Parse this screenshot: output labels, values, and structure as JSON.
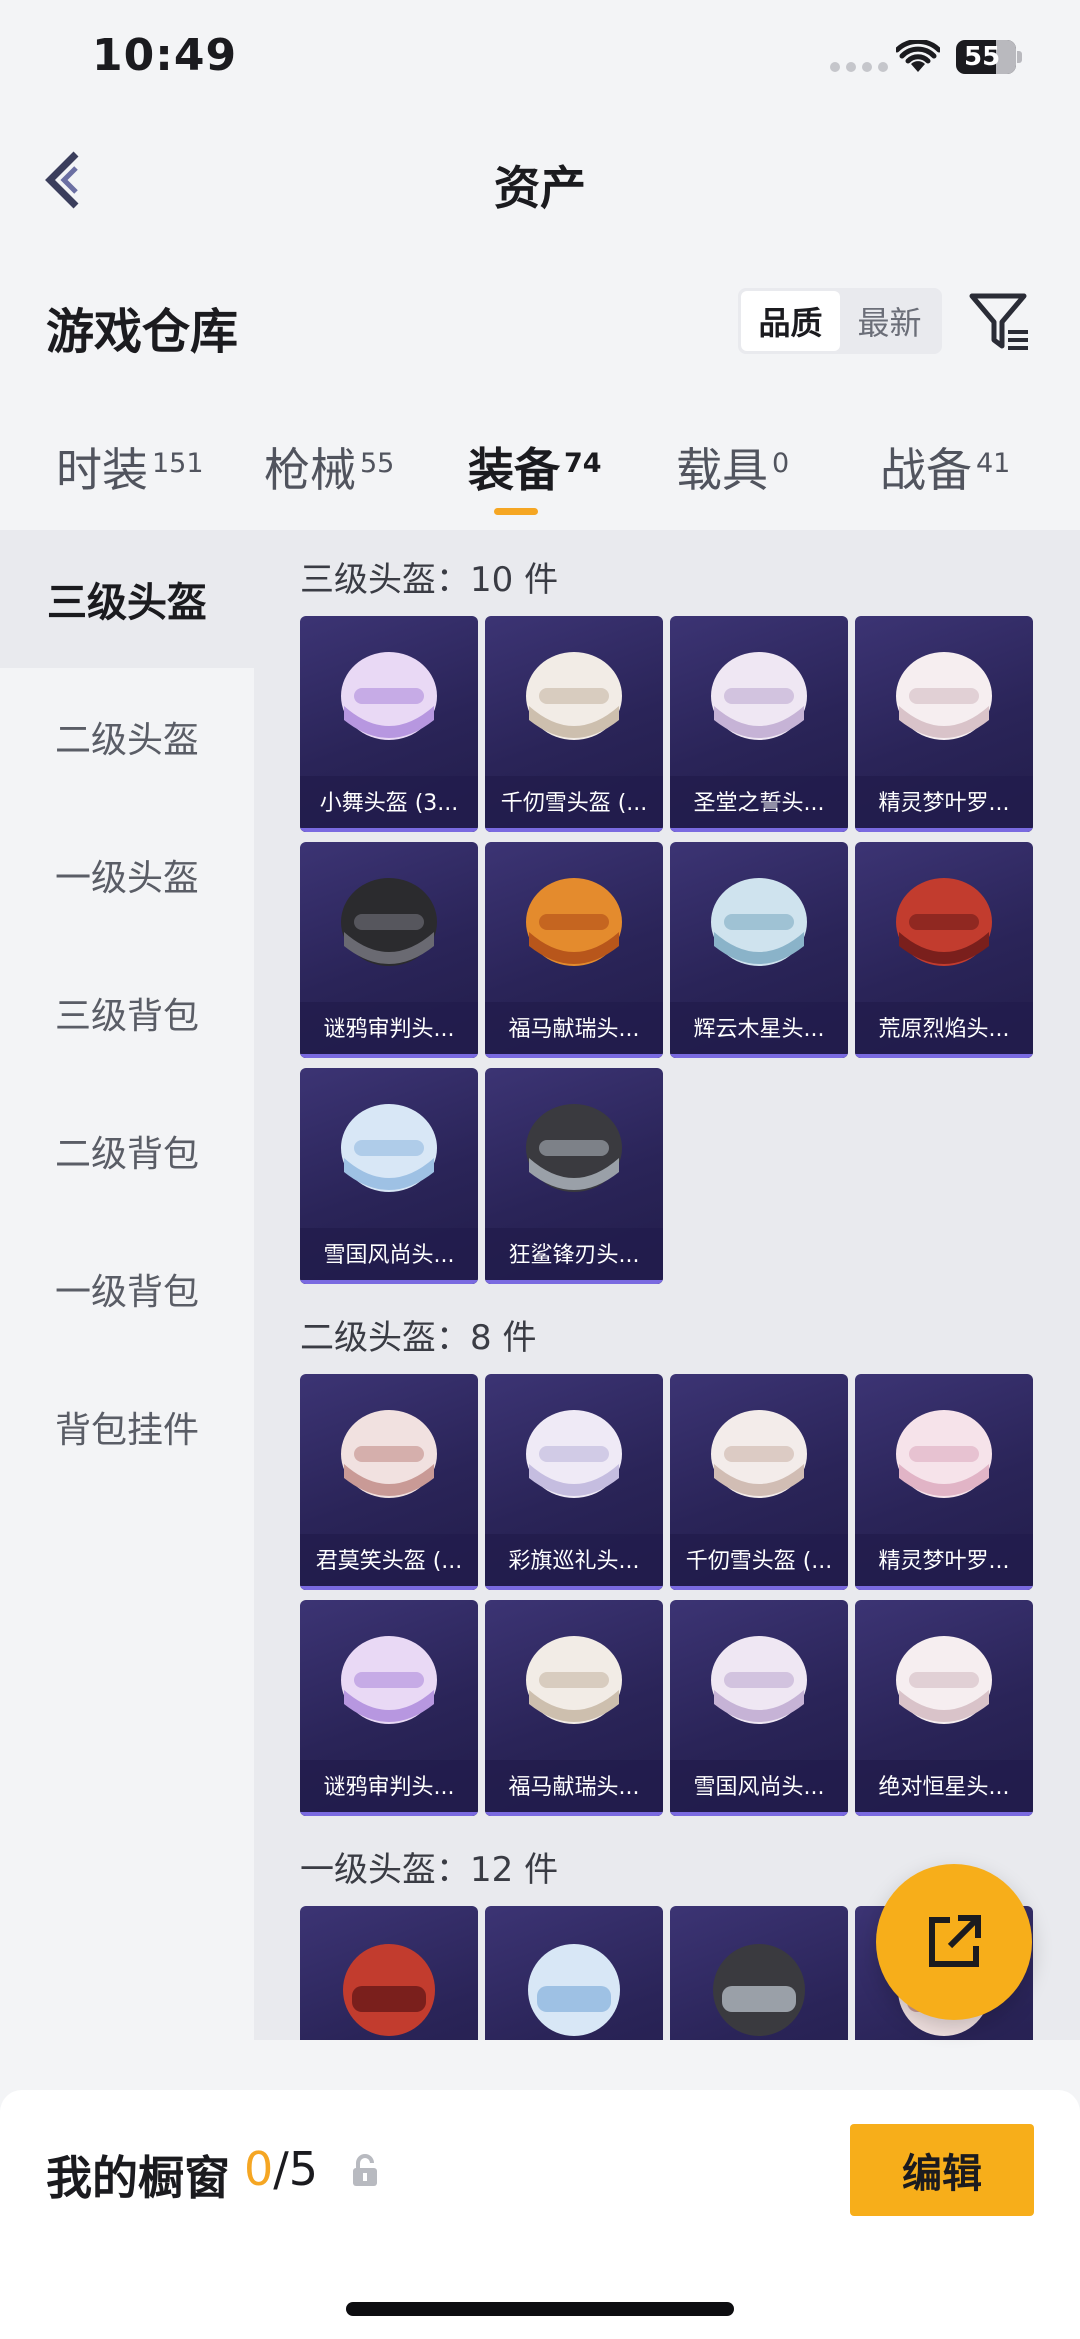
{
  "status": {
    "time": "10:49",
    "battery": "55"
  },
  "nav": {
    "title": "资产"
  },
  "header": {
    "title": "游戏仓库",
    "sort_options": [
      "品质",
      "最新"
    ]
  },
  "tabs": [
    {
      "label": "时装",
      "count": "151"
    },
    {
      "label": "枪械",
      "count": "55"
    },
    {
      "label": "装备",
      "count": "74"
    },
    {
      "label": "载具",
      "count": "0"
    },
    {
      "label": "战备",
      "count": "41"
    }
  ],
  "sidebar": [
    "三级头盔",
    "二级头盔",
    "一级头盔",
    "三级背包",
    "二级背包",
    "一级背包",
    "背包挂件"
  ],
  "groups": [
    {
      "title": "三级头盔：10 件",
      "items": [
        "小舞头盔 (3...",
        "千仞雪头盔 (...",
        "圣堂之誓头...",
        "精灵梦叶罗...",
        "谜鸦审判头...",
        "福马献瑞头...",
        "辉云木星头...",
        "荒原烈焰头...",
        "雪国风尚头...",
        "狂鲨锋刃头..."
      ]
    },
    {
      "title": "二级头盔：8 件",
      "items": [
        "君莫笑头盔 (...",
        "彩旗巡礼头...",
        "千仞雪头盔 (...",
        "精灵梦叶罗...",
        "谜鸦审判头...",
        "福马献瑞头...",
        "雪国风尚头...",
        "绝对恒星头..."
      ]
    },
    {
      "title": "一级头盔：12 件",
      "items": []
    }
  ],
  "bottom": {
    "label": "我的橱窗",
    "count_current": "0",
    "count_total": "/5",
    "edit_label": "编辑"
  },
  "colors": {
    "accent": "#f7ae1a",
    "card_bg": "#2a2458"
  }
}
